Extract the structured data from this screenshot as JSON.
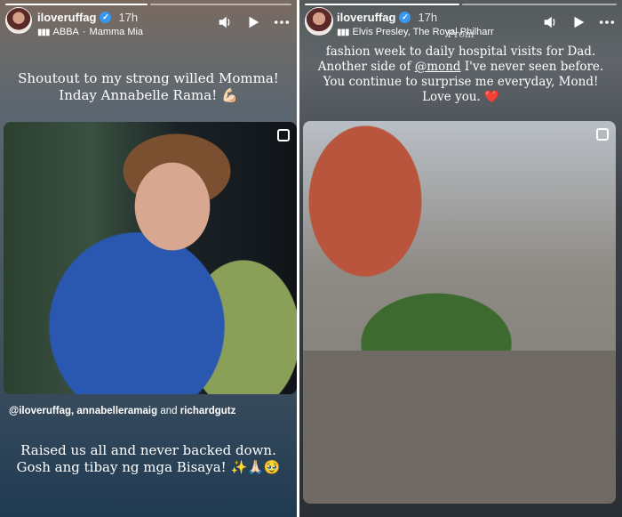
{
  "left_story": {
    "username": "iloveruffag",
    "time": "17h",
    "music_artist": "ABBA",
    "music_sep": "·",
    "music_title": "Mamma Mia",
    "caption_top_line1": "Shoutout to my strong willed Momma!",
    "caption_top_line2": "Inday Annabelle Rama! 💪🏻",
    "tags": {
      "tag1": "@iloveruffag",
      "tag2": "annabelleramaig",
      "and": "and",
      "tag3": "richardgutz"
    },
    "caption_bottom_line1": "Raised us all and never backed down.",
    "caption_bottom_line2": "Gosh ang tibay ng mga Bisaya! ✨🙏🏻🥹"
  },
  "right_story": {
    "username": "iloveruffag",
    "time": "17h",
    "music": "Elvis Presley, The Royal Philharr",
    "caption_from": "From",
    "caption_line1": "fashion week to daily hospital visits for Dad.",
    "caption_line2_pre": "Another side of ",
    "caption_line2_mention": "@mond",
    "caption_line2_post": " I've never seen before.",
    "caption_line3": "You continue to surprise me everyday, Mond!",
    "caption_line4": "Love you. ",
    "heart": "❤️"
  },
  "icons": {
    "verified": "verified-badge-icon",
    "music": "music-bars-icon",
    "sound": "speaker-icon",
    "play": "play-icon",
    "more": "more-options-icon",
    "photo_corner": "square-overlay-icon"
  },
  "colors": {
    "verified": "#3897f0",
    "heart": "#e0245e",
    "text": "#ffffff"
  }
}
